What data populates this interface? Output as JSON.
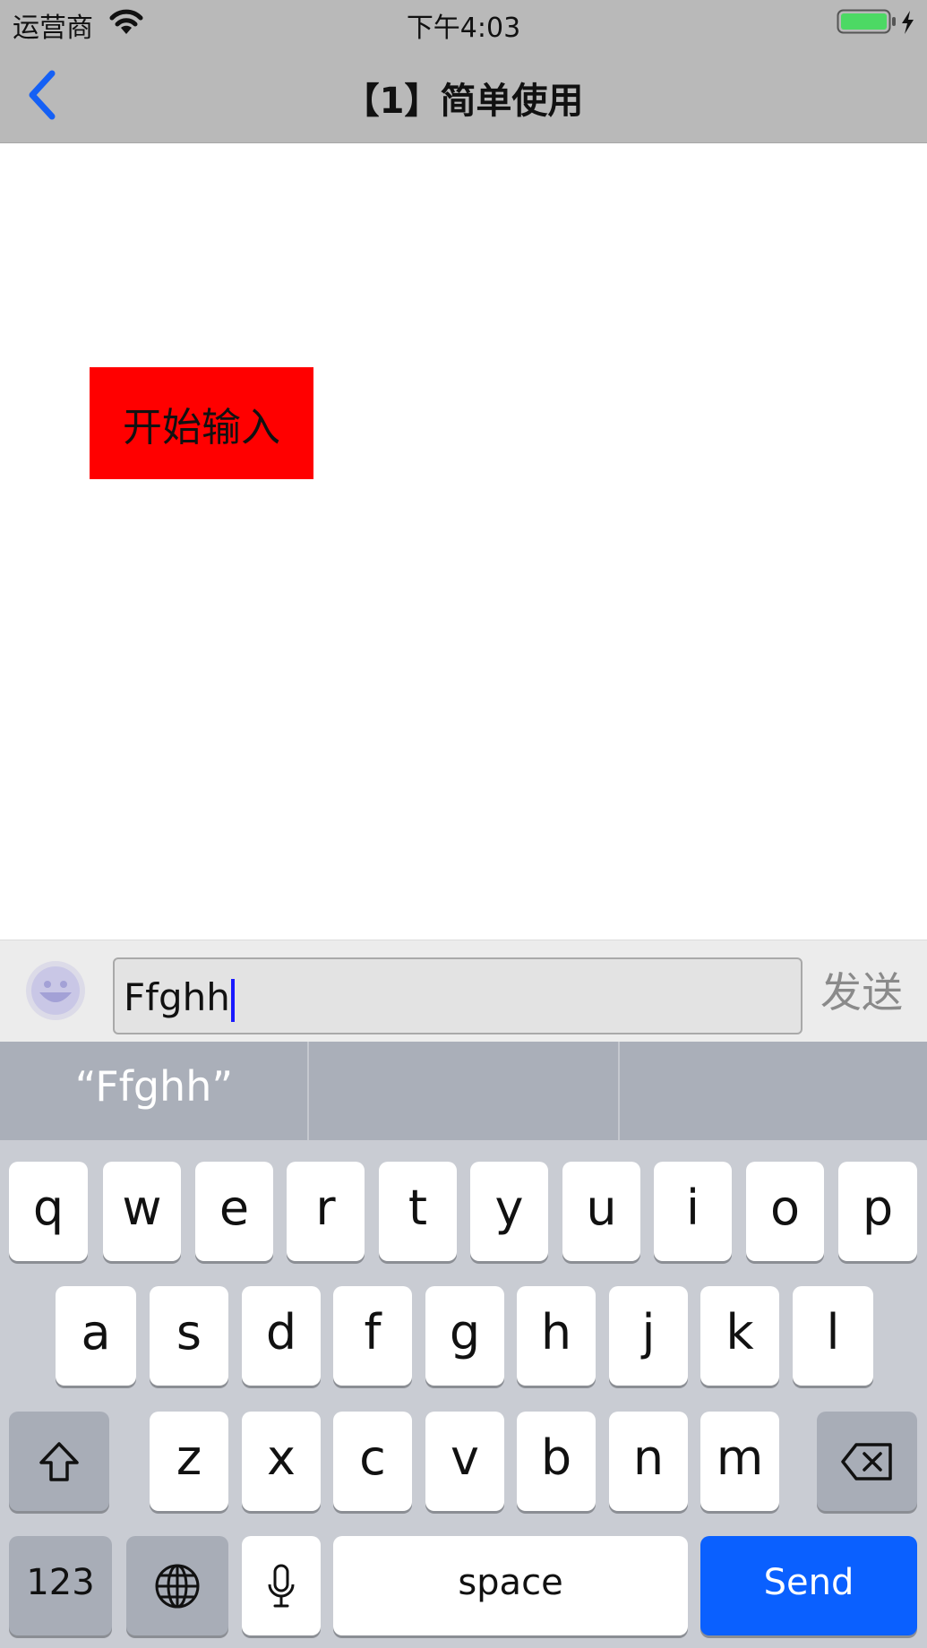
{
  "status_bar": {
    "carrier": "运营商",
    "time": "下午4:03",
    "wifi_icon": "wifi-icon",
    "battery_icon": "battery-charging-icon"
  },
  "nav": {
    "title": "【1】简单使用",
    "back_icon": "chevron-left-icon",
    "accent": "#1560f5"
  },
  "main": {
    "start_button": "开始输入",
    "start_button_color": "#ff0000"
  },
  "input_bar": {
    "emoji_icon": "smiley-face-icon",
    "value": "Ffghh",
    "send_label": "发送"
  },
  "predictive": {
    "suggestions": [
      "“Ffghh”",
      "",
      ""
    ]
  },
  "keyboard": {
    "row1": [
      "q",
      "w",
      "e",
      "r",
      "t",
      "y",
      "u",
      "i",
      "o",
      "p"
    ],
    "row2": [
      "a",
      "s",
      "d",
      "f",
      "g",
      "h",
      "j",
      "k",
      "l"
    ],
    "row3": [
      "z",
      "x",
      "c",
      "v",
      "b",
      "n",
      "m"
    ],
    "numbers_label": "123",
    "space_label": "space",
    "send_label": "Send",
    "send_color": "#0a60ff",
    "shift_icon": "shift-arrow-icon",
    "delete_icon": "backspace-icon",
    "globe_icon": "globe-icon",
    "mic_icon": "microphone-icon"
  }
}
